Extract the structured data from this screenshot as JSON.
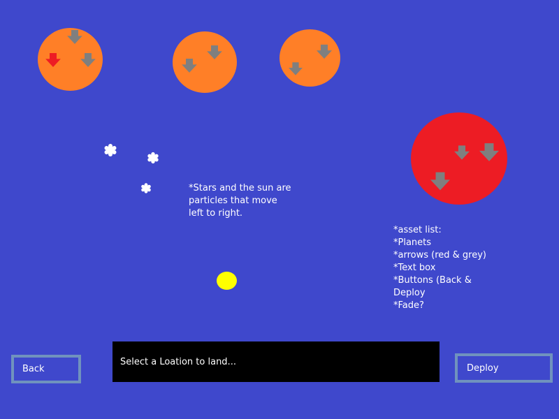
{
  "colors": {
    "background": "#3f48cc",
    "planet_orange": "#ff7f27",
    "planet_red": "#ed1c24",
    "arrow_grey": "#7f7f7f",
    "arrow_red": "#ed1c24",
    "sun": "#ffff00",
    "button_border": "#7092be",
    "textbox_bg": "#000000"
  },
  "icons": {
    "arrow": "down-arrow-icon",
    "star": "star-particle-icon"
  },
  "notes": {
    "particles": [
      "*Stars and the sun are",
      "particles that move",
      "left to right."
    ],
    "asset_list": [
      "*asset list:",
      "*Planets",
      "*arrows (red & grey)",
      "*Text box",
      "*Buttons (Back &",
      "Deploy",
      "*Fade?"
    ]
  },
  "textbox": {
    "message": "Select a Loation to land..."
  },
  "buttons": {
    "back": "Back",
    "deploy": "Deploy"
  }
}
